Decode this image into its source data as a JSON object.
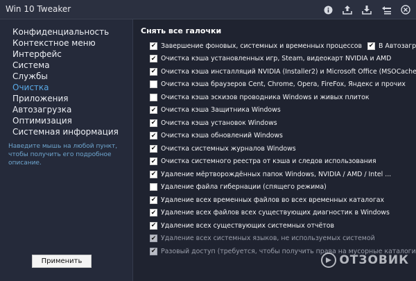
{
  "app": {
    "title": "Win 10 Tweaker"
  },
  "toolbar": {
    "icons": [
      "info-icon",
      "upload-icon",
      "download-icon",
      "undo-settings-icon",
      "close-icon"
    ]
  },
  "sidebar": {
    "items": [
      {
        "label": "Конфиденциальность",
        "active": false
      },
      {
        "label": "Контекстное меню",
        "active": false
      },
      {
        "label": "Интерфейс",
        "active": false
      },
      {
        "label": "Система",
        "active": false
      },
      {
        "label": "Службы",
        "active": false
      },
      {
        "label": "Очистка",
        "active": true
      },
      {
        "label": "Приложения",
        "active": false
      },
      {
        "label": "Автозагрузка",
        "active": false
      },
      {
        "label": "Оптимизация",
        "active": false
      },
      {
        "label": "Системная информация",
        "active": false
      }
    ],
    "hint": "Наведите мышь на любой пункт, чтобы получить его подробное описание.",
    "apply_label": "Применить"
  },
  "main": {
    "uncheck_all_label": "Снять все галочки",
    "options": [
      {
        "label": "Завершение фоновых, системных и временных процессов",
        "checked": true,
        "extra": {
          "label": "В Автозагрузку",
          "checked": true
        }
      },
      {
        "label": "Очистка кэша установленных игр, Steam, видеокарт NVIDIA и AMD",
        "checked": true
      },
      {
        "label": "Очистка кэша инсталляций NVIDIA (Installer2) и Microsoft Office (MSOCache)",
        "checked": true
      },
      {
        "label": "Очистка кэша браузеров Cent, Chrome, Opera, FireFox, Яндекс и прочих",
        "checked": false
      },
      {
        "label": "Очистка кэша эскизов проводника Windows и живых плиток",
        "checked": false
      },
      {
        "label": "Очистка кэша Защитника Windows",
        "checked": true
      },
      {
        "label": "Очистка кэша установок Windows",
        "checked": true
      },
      {
        "label": "Очистка кэша обновлений Windows",
        "checked": true
      },
      {
        "label": "Очистка системных журналов Windows",
        "checked": true
      },
      {
        "label": "Очистка системного реестра от кэша и следов использования",
        "checked": true
      },
      {
        "label": "Удаление мёртворождённых папок Windows, NVIDIA / AMD / Intel ...",
        "checked": true
      },
      {
        "label": "Удаление файла гибернации (спящего режима)",
        "checked": false
      },
      {
        "label": "Удаление всех временных файлов во всех временных каталогах",
        "checked": true
      },
      {
        "label": "Удаление всех файлов всех существующих диагностик в Windows",
        "checked": true
      },
      {
        "label": "Удаление всех существующих системных отчётов",
        "checked": true
      },
      {
        "label": "Удаление всех системных языков, не используемых системой",
        "checked": true,
        "dim": true
      },
      {
        "label": "Разовый доступ (требуется, чтобы получить права на мусорные каталоги)",
        "checked": true,
        "dim": true
      }
    ]
  },
  "watermark": {
    "text": "ОТЗОВИК"
  }
}
